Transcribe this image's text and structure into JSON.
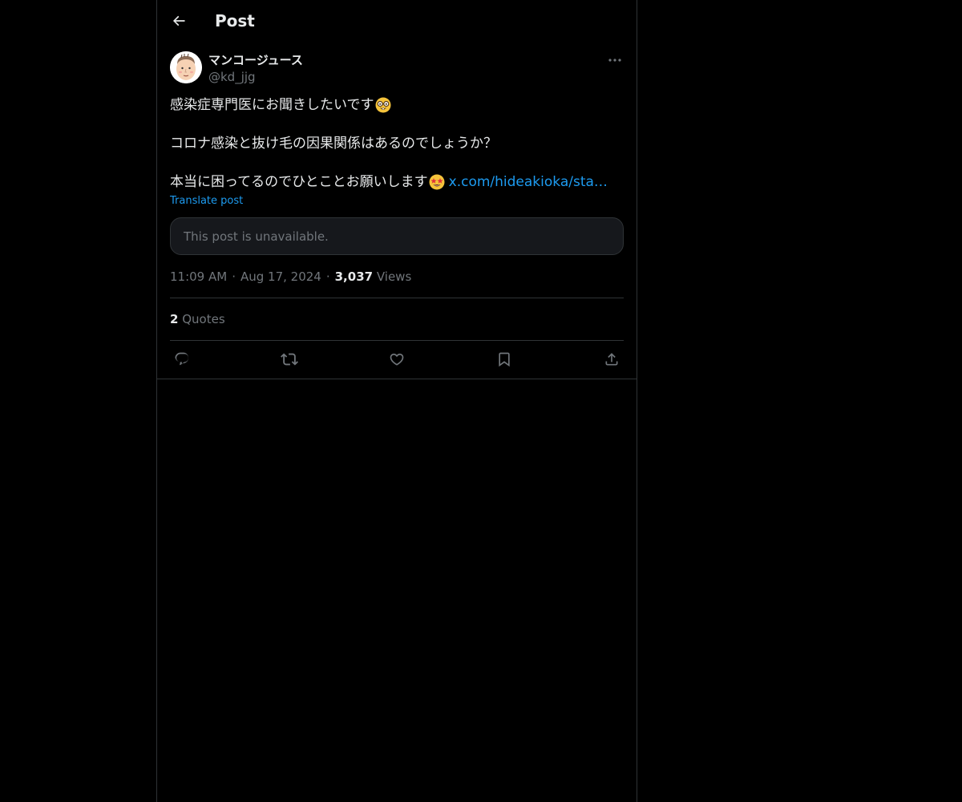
{
  "header": {
    "title": "Post"
  },
  "author": {
    "name": "マンコージュース",
    "handle": "@kd_jjg"
  },
  "post": {
    "line1": "感染症専門医にお聞きしたいです",
    "line1_emoji": "nerd-face-emoji",
    "line2": "コロナ感染と抜け毛の因果関係はあるのでしょうか？",
    "line3": "本当に困ってるのでひとことお願いします",
    "line3_emoji": "star-struck-emoji",
    "link": "x.com/hideakioka/sta…",
    "translate": "Translate post",
    "unavailable": "This post is unavailable."
  },
  "meta": {
    "time": "11:09 AM",
    "separator": "·",
    "date": "Aug 17, 2024",
    "views_count": "3,037",
    "views_label": "Views"
  },
  "stats": {
    "quotes_count": "2",
    "quotes_label": "Quotes"
  },
  "icons": {
    "back": "back-arrow-icon",
    "more": "more-dots-icon",
    "reply": "reply-icon",
    "repost": "repost-icon",
    "like": "like-icon",
    "bookmark": "bookmark-icon",
    "share": "share-icon"
  },
  "colors": {
    "background": "#000000",
    "text": "#e7e9ea",
    "muted": "#71767b",
    "accent": "#1d9bf0",
    "border": "#2f3336"
  }
}
